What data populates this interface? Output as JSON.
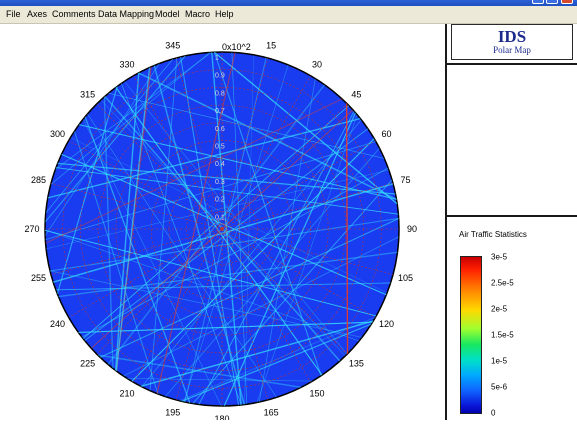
{
  "menu": [
    "File",
    "Axes",
    "Comments",
    "Data Mapping",
    "Model",
    "Macro",
    "Help"
  ],
  "header": {
    "title": "IDS",
    "subtitle": "Polar Map"
  },
  "polar": {
    "scale_label": "0x10^2",
    "angle_labels": [
      "345",
      "15",
      "330",
      "30",
      "315",
      "45",
      "300",
      "60",
      "285",
      "75",
      "270",
      "90",
      "255",
      "105",
      "240",
      "120",
      "225",
      "135",
      "210",
      "150",
      "195",
      "165",
      "180"
    ],
    "radial_labels": [
      "1",
      "0.9",
      "0.8",
      "0.7",
      "0.6",
      "0.5",
      "0.4",
      "0.3",
      "0.2",
      "0.1"
    ]
  },
  "colorbar": {
    "title": "Air Traffic Statistics",
    "ticks": [
      "3e-5",
      "2.5e-5",
      "2e-5",
      "1.5e-5",
      "1e-5",
      "5e-6",
      "0"
    ]
  },
  "colors": {
    "plot_bg": "#1a3cf0",
    "track": "#35e0ff",
    "hot": "#ff3a10",
    "grid": "#c03030"
  }
}
